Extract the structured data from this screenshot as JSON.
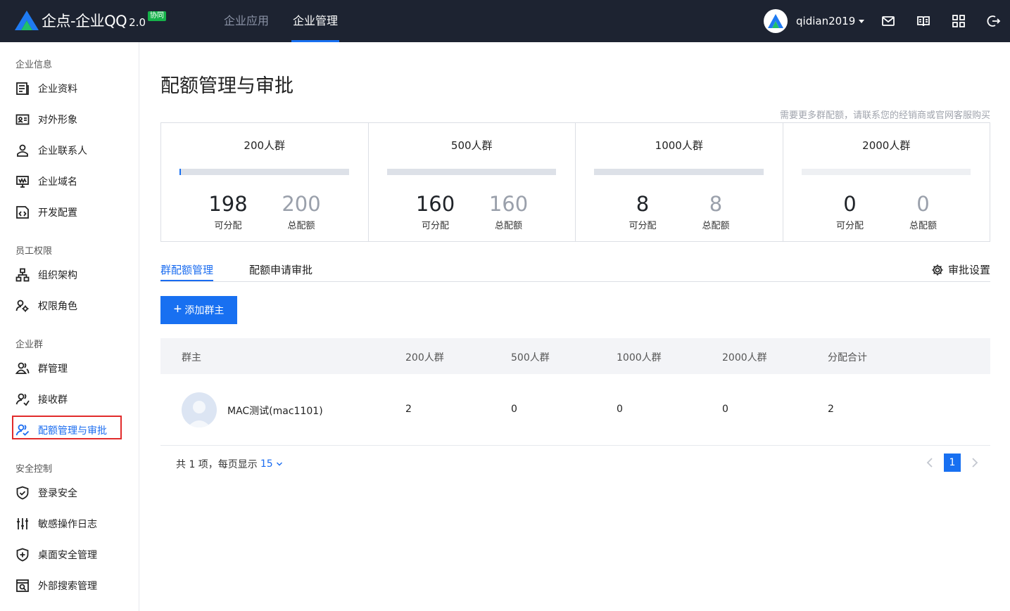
{
  "header": {
    "logo_text": "企点-企业QQ",
    "logo_version": "2.0",
    "logo_badge": "协同",
    "nav": [
      {
        "label": "企业应用",
        "active": false
      },
      {
        "label": "企业管理",
        "active": true
      }
    ],
    "username": "qidian2019",
    "icons": [
      "mail-icon",
      "book-icon",
      "apps-icon",
      "logout-icon"
    ]
  },
  "sidebar": {
    "groups": [
      {
        "title": "企业信息",
        "items": [
          {
            "label": "企业资料",
            "icon": "profile-icon"
          },
          {
            "label": "对外形象",
            "icon": "id-card-icon"
          },
          {
            "label": "企业联系人",
            "icon": "contact-icon"
          },
          {
            "label": "企业域名",
            "icon": "domain-icon"
          },
          {
            "label": "开发配置",
            "icon": "code-icon"
          }
        ]
      },
      {
        "title": "员工权限",
        "items": [
          {
            "label": "组织架构",
            "icon": "org-chart-icon"
          },
          {
            "label": "权限角色",
            "icon": "role-icon"
          }
        ]
      },
      {
        "title": "企业群",
        "items": [
          {
            "label": "群管理",
            "icon": "group-icon"
          },
          {
            "label": "接收群",
            "icon": "receive-group-icon"
          },
          {
            "label": "配额管理与审批",
            "icon": "quota-icon",
            "active": true
          }
        ]
      },
      {
        "title": "安全控制",
        "items": [
          {
            "label": "登录安全",
            "icon": "shield-check-icon"
          },
          {
            "label": "敏感操作日志",
            "icon": "sliders-icon"
          },
          {
            "label": "桌面安全管理",
            "icon": "shield-plus-icon"
          },
          {
            "label": "外部搜索管理",
            "icon": "search-box-icon"
          }
        ]
      }
    ]
  },
  "main": {
    "title": "配额管理与审批",
    "hint": "需要更多群配额，请联系您的经销商或官网客服购买",
    "quota_cards": [
      {
        "title": "200人群",
        "available": "198",
        "available_label": "可分配",
        "total": "200",
        "total_label": "总配额",
        "used_fraction": 0.01
      },
      {
        "title": "500人群",
        "available": "160",
        "available_label": "可分配",
        "total": "160",
        "total_label": "总配额",
        "used_fraction": 0
      },
      {
        "title": "1000人群",
        "available": "8",
        "available_label": "可分配",
        "total": "8",
        "total_label": "总配额",
        "used_fraction": 0
      },
      {
        "title": "2000人群",
        "available": "0",
        "available_label": "可分配",
        "total": "0",
        "total_label": "总配额",
        "used_fraction": 0
      }
    ],
    "tabs": [
      {
        "label": "群配额管理",
        "active": true
      },
      {
        "label": "配额申请审批",
        "active": false
      }
    ],
    "approval_settings": "审批设置",
    "add_button": "添加群主",
    "table": {
      "columns": [
        "群主",
        "200人群",
        "500人群",
        "1000人群",
        "2000人群",
        "分配合计"
      ],
      "rows": [
        {
          "owner": "MAC测试(mac1101)",
          "c200": "2",
          "c500": "0",
          "c1000": "0",
          "c2000": "0",
          "sum": "2"
        }
      ]
    },
    "pagination": {
      "summary": "共 1 项，每页显示",
      "page_size": "15",
      "current_page": "1"
    }
  },
  "colors": {
    "accent": "#1870f1",
    "topbar": "#1d2331",
    "highlight": "#e12b2b"
  }
}
